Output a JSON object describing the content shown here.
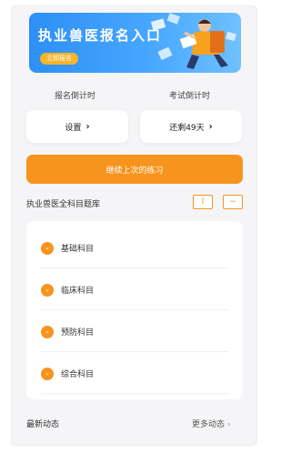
{
  "banner": {
    "title": "执业兽医报名入口",
    "cta": "立即报名"
  },
  "countdown": {
    "signup_label": "报名倒计时",
    "exam_label": "考试倒计时",
    "signup_button": "设置",
    "exam_button": "还剩49天",
    "chevron": "›"
  },
  "continue_button": "继续上次的练习",
  "question_bank": {
    "title": "执业兽医全科目题库",
    "icon_a": "I",
    "icon_b": "−",
    "subjects": [
      {
        "label": "基础科目"
      },
      {
        "label": "临床科目"
      },
      {
        "label": "预防科目"
      },
      {
        "label": "综合科目"
      }
    ]
  },
  "news": {
    "title": "最新动态",
    "more": "更多动态",
    "more_arrow": "›"
  },
  "colors": {
    "accent": "#f7941d",
    "banner_blue": "#2e8ff5",
    "background": "#f5f5f7"
  }
}
